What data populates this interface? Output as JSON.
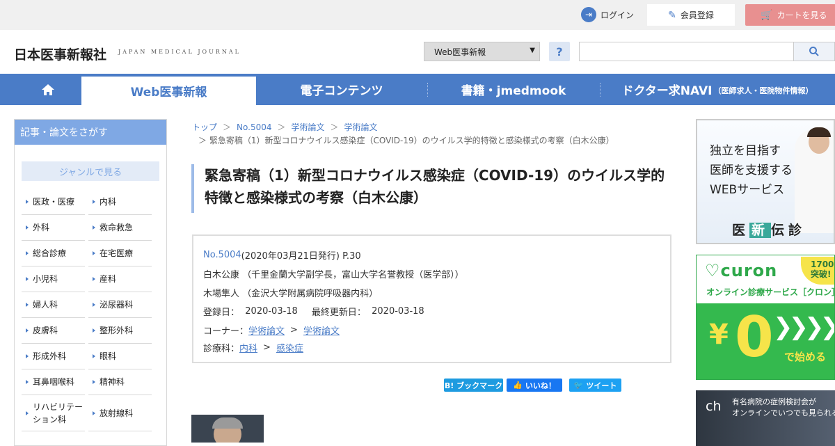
{
  "header": {
    "login": "ログイン",
    "register": "会員登録",
    "cart": "カートを見る",
    "logo": "日本医事新報社",
    "logo_sub": "JAPAN MEDICAL JOURNAL",
    "search_select": "Web医事新報",
    "help": "?"
  },
  "nav": {
    "web": "Web医事新報",
    "econtents": "電子コンテンツ",
    "books": "書籍・jmedmook",
    "doctor": "ドクター求NAVI",
    "doctor_sub": "（医師求人・医院物件情報）"
  },
  "sidebar": {
    "title": "記事・論文をさがす",
    "genre": "ジャンルで見る",
    "categories": [
      [
        "医政・医療",
        "内科"
      ],
      [
        "外科",
        "救命救急"
      ],
      [
        "総合診療",
        "在宅医療"
      ],
      [
        "小児科",
        "産科"
      ],
      [
        "婦人科",
        "泌尿器科"
      ],
      [
        "皮膚科",
        "整形外科"
      ],
      [
        "形成外科",
        "眼科"
      ],
      [
        "耳鼻咽喉科",
        "精神科"
      ],
      [
        "リハビリテーション科",
        "放射線科"
      ]
    ]
  },
  "breadcrumb": {
    "items": [
      "トップ",
      "No.5004",
      "学術論文",
      "学術論文"
    ],
    "current": "＞ 緊急寄稿（1）新型コロナウイルス感染症（COVID-19）のウイルス学的特徴と感染様式の考察（白木公康）"
  },
  "article": {
    "title": "緊急寄稿（1）新型コロナウイルス感染症（COVID-19）のウイルス学的特徴と感染様式の考察（白木公康）",
    "issue_link": "No.5004",
    "issue_meta": " (2020年03月21日発行) P.30",
    "author1": "白木公康 （千里金蘭大学副学長，富山大学名誉教授（医学部））",
    "author2": "木場隼人 （金沢大学附属病院呼吸器内科）",
    "registered_label": "登録日：",
    "registered": "2020-03-18",
    "updated_label": "最終更新日：",
    "updated": "2020-03-18",
    "corner_label": "コーナー：",
    "corner1": "学術論文",
    "corner2": "学術論文",
    "dept_label": "診療科：",
    "dept1": "内科",
    "dept2": "感染症"
  },
  "share": {
    "hatena": "B! ブックマーク",
    "like": "いいね！",
    "tweet": "ツイート"
  },
  "ads": {
    "ad1_line1": "独立を目指す",
    "ad1_line2": "医師を支援する",
    "ad1_line3": "WEBサービス",
    "ad1_brand_a": "医",
    "ad1_brand_b": "新",
    "ad1_brand_c": "伝診",
    "ad2_logo": "curon",
    "ad2_badge": "1700 突破!",
    "ad2_sub": "オンライン診療サービス［クロン］",
    "ad2_yen": "¥",
    "ad2_zero": "0",
    "ad2_start": "で始める",
    "ad3_ch": "ch",
    "ad3_line1": "有名病院の症例検討会が",
    "ad3_line2": "オンラインでいつでも見られる"
  },
  "colors": {
    "accent": "#4a7cc7",
    "sidebar_head": "#7fa8e4",
    "cart": "#e89090",
    "curon": "#2ea84a"
  }
}
